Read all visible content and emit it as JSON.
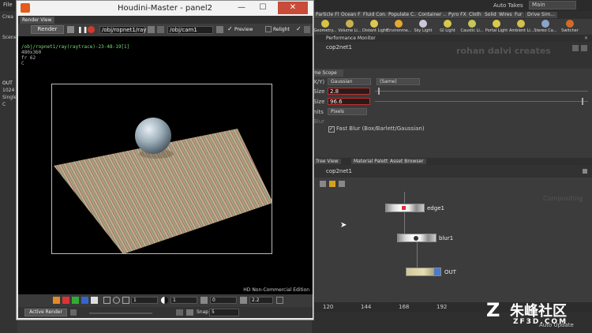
{
  "menubar": {
    "file": "File",
    "auto_takes": "Auto Takes",
    "main": "Main"
  },
  "shelf": {
    "tabs": [
      "Particle Fl...",
      "Ocean FX",
      "Fluid Con...",
      "Populate C...",
      "Container ...",
      "Pyro FX",
      "Cloth",
      "Solid",
      "Wires",
      "Fur",
      "Drive Sim..."
    ],
    "tools": [
      "Geometry...",
      "Volume Li...",
      "Distant Light",
      "Environme...",
      "Sky Light",
      "GI Light",
      "Caustic Li...",
      "Portal Light",
      "Ambient Li...",
      "Stereo Ca...",
      "Switcher"
    ]
  },
  "left_strip": [
    "Crea",
    "Scene",
    "OUT",
    "1024",
    "Single",
    "C"
  ],
  "window": {
    "title": "Houdini-Master - panel2",
    "minimize": "—",
    "maximize": "☐",
    "close": "✕"
  },
  "render_view": {
    "tab_label": "Render View",
    "render_button": "Render",
    "rop_path": "/obj/ropnet1/ray",
    "camera_path": "/obj/cam1",
    "preview_label": "Preview",
    "relight_label": "Relight",
    "overlay_lines": [
      "/obj/ropnet1/ray(raytrace)-23-48-19[1]",
      "480x360",
      "fr 62",
      "C"
    ],
    "edition_label": "HD Non-Commercial Edition",
    "zoom_value": "1",
    "exposure_value": "1",
    "gamma_value": "0",
    "gamma2_value": "2.2",
    "active_render": "Active Render",
    "snap_label": "Snap",
    "snap_value": "5"
  },
  "right_pane": {
    "performance_tab": "Performance Monitor",
    "node_path": "cop2net1",
    "watermark_line": "rohan dalvi creates",
    "params_tab": "me Scope",
    "filter_label": "X/Y)",
    "filter_value": "Gaussian",
    "filter_value2": "(Same)",
    "size_label": "Size",
    "size_value": "2.8",
    "size2_label": "Size",
    "size2_value": "96.6",
    "units_label": "nits",
    "units_value": "Pixels",
    "blur_label": "Blur",
    "fast_blur_label": "Fast Blur (Box/Barlett/Gaussian)",
    "network_tabs": [
      "Tree View",
      "Material Palette",
      "Asset Browser"
    ],
    "network_path": "cop2net1",
    "compositing_label": "Compositing",
    "nodes": [
      "edge1",
      "blur1",
      "OUT"
    ],
    "timeline_ticks": [
      "120",
      "144",
      "168",
      "192"
    ],
    "auto_update": "Auto Update"
  },
  "watermark": {
    "text": "朱峰社区",
    "sub": "ZF3D.COM"
  }
}
